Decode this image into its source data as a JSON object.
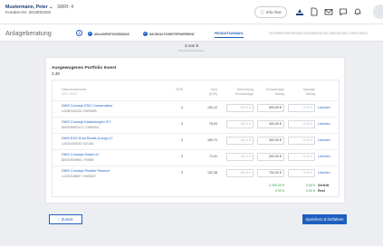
{
  "header": {
    "customer_name": "Mustermann, Peter",
    "customer_sri": "SRRI: 4",
    "customer_number": "Kunden-Nr. 20190015S",
    "infotext_label": "Info-Text"
  },
  "stepper": {
    "title": "Anlageberatung",
    "steps": [
      {
        "label": "ANLAGEENTSCHEIDUNG",
        "state": "done"
      },
      {
        "label": "NACHHALTIGKEITSPRÄFERENZ",
        "state": "done"
      },
      {
        "label": "PRODUKTAUSWAHL",
        "state": "active"
      },
      {
        "label": "SICHERHEITSPRÜFUNG",
        "state": "inactive"
      },
      {
        "label": "DOKUMENTATION",
        "state": "inactive"
      },
      {
        "label": "ABSCHLUSS & PROTOKOLL",
        "state": "inactive"
      }
    ]
  },
  "step_indicator": {
    "count": "3 von 5",
    "subtitle": "PRODUKTAUSWAHL"
  },
  "portfolio": {
    "title": "Ausgewogenes Portfolio Invest",
    "value": "3,30",
    "columns": {
      "name": "Instrumentenname",
      "isin": "ISIN / WKN",
      "srri": "SRRI",
      "price": "Kurs",
      "price_unit": "(EUR)",
      "calc": "Berechnung",
      "calc2": "Einmalanlage",
      "once": "Einmalanlage",
      "once2": "Betrag",
      "savings": "Sparplan",
      "savings2": "Betrag"
    },
    "rows": [
      {
        "name": "DWS Concept ESG Conservative",
        "isin": "LU0387402125 / DWS0WS",
        "srri": "4",
        "price": "132,12",
        "calc": "250,0 ▾",
        "once": "500,00 €",
        "savings": "0,00 €",
        "action": "Löschen"
      },
      {
        "name": "DWS Concept Kaldemorgen ITC",
        "isin": "DE000DWS1U17 / DWS0DX",
        "srri": "3",
        "price": "78,93",
        "calc": "150,0 ▾",
        "once": "300,00 €",
        "savings": "0,00 €",
        "action": "Löschen"
      },
      {
        "name": "DWS ESG Euro Bonds (Long) LC",
        "isin": "LU0210301635 / 621316",
        "srri": "3",
        "price": "169,72",
        "calc": "150,0 ▾",
        "once": "300,00 €",
        "savings": "0,00 €",
        "action": "Löschen"
      },
      {
        "name": "DWS Concept Smart LD",
        "isin": "DE0009769891 / 976989",
        "srri": "3",
        "price": "71,91",
        "calc": "100,0 ▾",
        "once": "200,00 €",
        "savings": "0,00 €",
        "action": "Löschen"
      },
      {
        "name": "DWS Concept Flexible Reserve",
        "isin": "LU1313185497 / DWS2AF",
        "srri": "3",
        "price": "132,38",
        "calc": "350,0 ▾",
        "once": "700,00 €",
        "savings": "0,00 €",
        "action": "Löschen"
      }
    ],
    "totals": {
      "once_total": "2.000,00 €",
      "once_rest": "0,00 €",
      "savings_total": "0,00 €",
      "savings_rest": "0,00 €",
      "total_label": "Verteilt",
      "rest_label": "Rest"
    }
  },
  "footer": {
    "back_label": "Zurück",
    "next_label": "Speichern & fortfahren"
  },
  "colors": {
    "accent": "#1e5fbf",
    "success": "#2f9e44"
  }
}
